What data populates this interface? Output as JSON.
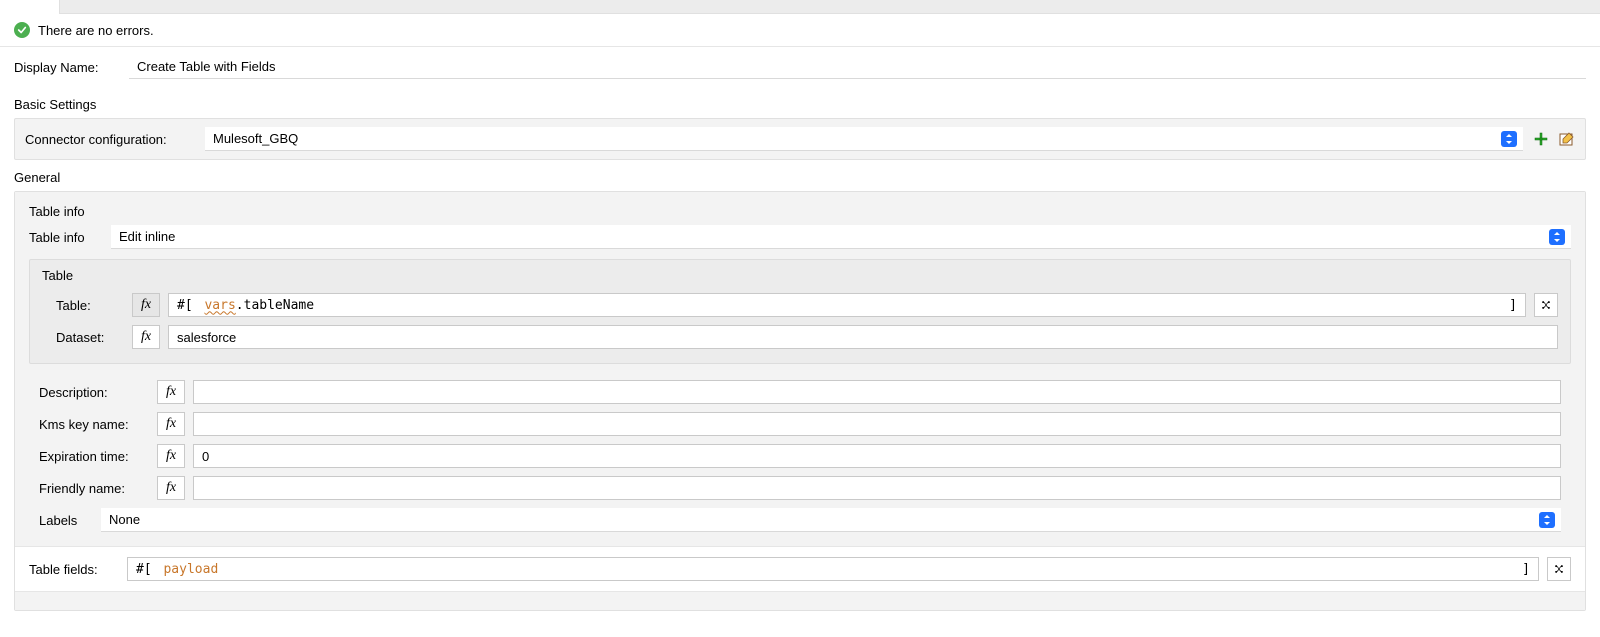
{
  "status": {
    "message": "There are no errors."
  },
  "displayName": {
    "label": "Display Name:",
    "value": "Create Table with Fields"
  },
  "basicSettings": {
    "title": "Basic Settings",
    "connectorLabel": "Connector configuration:",
    "connectorValue": "Mulesoft_GBQ"
  },
  "general": {
    "title": "General",
    "tableInfo": {
      "group": "Table info",
      "label": "Table info",
      "mode": "Edit inline"
    },
    "tableGroup": {
      "title": "Table",
      "table": {
        "label": "Table:",
        "exprPrefix": "#[ ",
        "exprVar": "vars",
        "exprDot": ".",
        "exprName": "tableName",
        "exprClose": "]"
      },
      "dataset": {
        "label": "Dataset:",
        "value": "salesforce"
      }
    },
    "description": {
      "label": "Description:",
      "value": ""
    },
    "kms": {
      "label": "Kms key name:",
      "value": ""
    },
    "expiration": {
      "label": "Expiration time:",
      "value": "0"
    },
    "friendly": {
      "label": "Friendly name:",
      "value": ""
    },
    "labels": {
      "label": "Labels",
      "value": "None"
    },
    "tableFields": {
      "label": "Table fields:",
      "exprPrefix": "#[ ",
      "exprVar": "payload",
      "exprClose": "]"
    }
  },
  "fxGlyph": "fx"
}
